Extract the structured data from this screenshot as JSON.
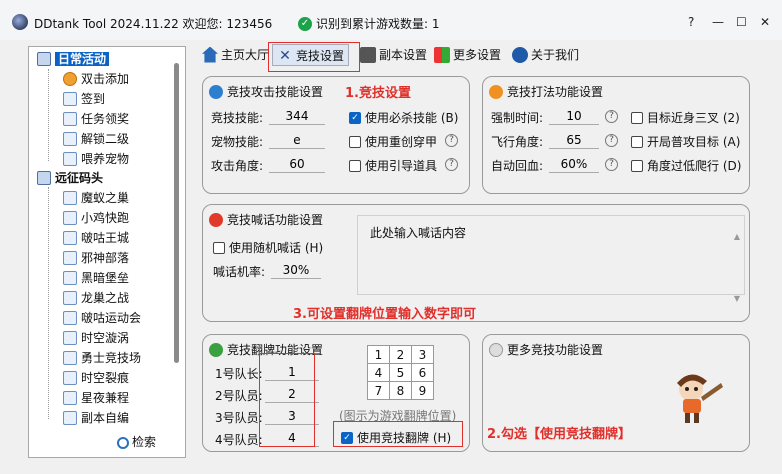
{
  "window": {
    "title": "DDtank Tool 2024.11.22 欢迎您: 123456",
    "status": "识别到累计游戏数量: 1",
    "help": "?",
    "minimize": "—",
    "maximize": "☐",
    "close": "✕"
  },
  "sidebar": {
    "groups": [
      {
        "label": "日常活动",
        "items": [
          "双击添加",
          "签到",
          "任务领奖",
          "解锁二级",
          "喂养宠物"
        ]
      },
      {
        "label": "远征码头",
        "items": [
          "魔蚁之巢",
          "小鸡快跑",
          "啵咕王城",
          "邪神部落",
          "黑暗堡垒",
          "龙巢之战",
          "啵咕运动会",
          "时空漩涡",
          "勇士竞技场",
          "时空裂痕",
          "星夜兼程",
          "副本自编"
        ]
      }
    ],
    "search": "检索"
  },
  "tabs": [
    "主页大厅",
    "竞技设置",
    "副本设置",
    "更多设置",
    "关于我们"
  ],
  "annotations": {
    "a1": "1.竞技设置",
    "a2": "2.勾选【使用竞技翻牌】",
    "a3": "3.可设置翻牌位置输入数字即可"
  },
  "attack": {
    "title": "竞技攻击技能设置",
    "skill_label": "竞技技能:",
    "skill_value": "344",
    "pet_label": "宠物技能:",
    "pet_value": "e",
    "angle_label": "攻击角度:",
    "angle_value": "60",
    "cb1": "使用必杀技能 (B)",
    "cb2": "使用重创穿甲",
    "cb3": "使用引导道具"
  },
  "fight": {
    "title": "竞技打法功能设置",
    "force_label": "强制时间:",
    "force_value": "10",
    "fly_label": "飞行角度:",
    "fly_value": "65",
    "heal_label": "自动回血:",
    "heal_value": "60%",
    "cb1": "目标近身三叉 (2)",
    "cb2": "开局普攻目标 (A)",
    "cb3": "角度过低爬行 (D)"
  },
  "taunt": {
    "title": "竞技喊话功能设置",
    "cb": "使用随机喊话 (H)",
    "rate_label": "喊话机率:",
    "rate_value": "30%",
    "placeholder": "此处输入喊话内容"
  },
  "flip": {
    "title": "竞技翻牌功能设置",
    "m1_label": "1号队长:",
    "m1_value": "1",
    "m2_label": "2号队员:",
    "m2_value": "2",
    "m3_label": "3号队员:",
    "m3_value": "3",
    "m4_label": "4号队员:",
    "m4_value": "4",
    "grid": [
      [
        "1",
        "2",
        "3"
      ],
      [
        "4",
        "5",
        "6"
      ],
      [
        "7",
        "8",
        "9"
      ]
    ],
    "hint": "(图示为游戏翻牌位置)",
    "cb": "使用竞技翻牌 (H)"
  },
  "more": {
    "title": "更多竞技功能设置"
  },
  "colors": {
    "accent": "#0b63c6",
    "annotation": "#e0302b"
  }
}
